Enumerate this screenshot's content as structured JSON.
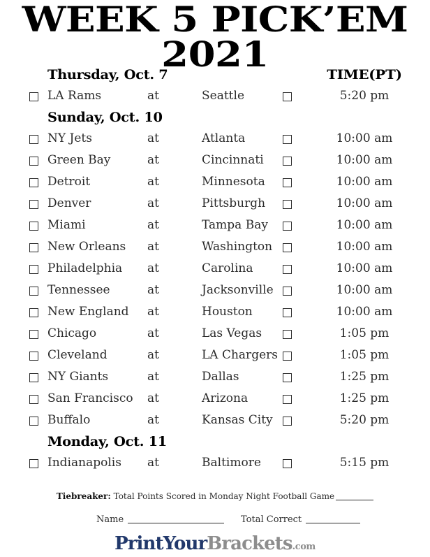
{
  "title": {
    "line1": "WEEK 5 PICK’EM",
    "line2": "2021"
  },
  "columns": {
    "time_header": "TIME(PT)",
    "at_word": "at"
  },
  "sections": [
    {
      "date": "Thursday, Oct. 7",
      "games": [
        {
          "away": "LA Rams",
          "at": "at",
          "home": "Seattle",
          "time": "5:20 pm"
        }
      ]
    },
    {
      "date": "Sunday, Oct. 10",
      "games": [
        {
          "away": "NY Jets",
          "at": "at",
          "home": "Atlanta",
          "time": "10:00 am"
        },
        {
          "away": "Green Bay",
          "at": "at",
          "home": "Cincinnati",
          "time": "10:00 am"
        },
        {
          "away": "Detroit",
          "at": "at",
          "home": "Minnesota",
          "time": "10:00 am"
        },
        {
          "away": "Denver",
          "at": "at",
          "home": "Pittsburgh",
          "time": "10:00 am"
        },
        {
          "away": "Miami",
          "at": "at",
          "home": "Tampa Bay",
          "time": "10:00 am"
        },
        {
          "away": "New Orleans",
          "at": "at",
          "home": "Washington",
          "time": "10:00 am"
        },
        {
          "away": "Philadelphia",
          "at": "at",
          "home": "Carolina",
          "time": "10:00 am"
        },
        {
          "away": "Tennessee",
          "at": "at",
          "home": "Jacksonville",
          "time": "10:00 am"
        },
        {
          "away": "New England",
          "at": "at",
          "home": "Houston",
          "time": "10:00 am"
        },
        {
          "away": "Chicago",
          "at": "at",
          "home": "Las Vegas",
          "time": "1:05 pm"
        },
        {
          "away": "Cleveland",
          "at": "at",
          "home": "LA Chargers",
          "time": "1:05 pm"
        },
        {
          "away": "NY Giants",
          "at": "at",
          "home": "Dallas",
          "time": "1:25 pm"
        },
        {
          "away": "San Francisco",
          "at": "at",
          "home": "Arizona",
          "time": "1:25 pm"
        },
        {
          "away": "Buffalo",
          "at": "at",
          "home": "Kansas City",
          "time": "5:20 pm"
        }
      ]
    },
    {
      "date": "Monday, Oct. 11",
      "games": [
        {
          "away": "Indianapolis",
          "at": "at",
          "home": "Baltimore",
          "time": "5:15 pm"
        }
      ]
    }
  ],
  "tiebreaker": {
    "label": "Tiebreaker:",
    "text": "Total Points Scored in Monday Night Football Game"
  },
  "footer_fields": {
    "name_label": "Name",
    "total_correct_label": "Total Correct"
  },
  "logo": {
    "part1": "PrintYour",
    "part2": "Brackets",
    "part3": ".com",
    "color1": "#21386b",
    "color2": "#8d8d8d"
  }
}
